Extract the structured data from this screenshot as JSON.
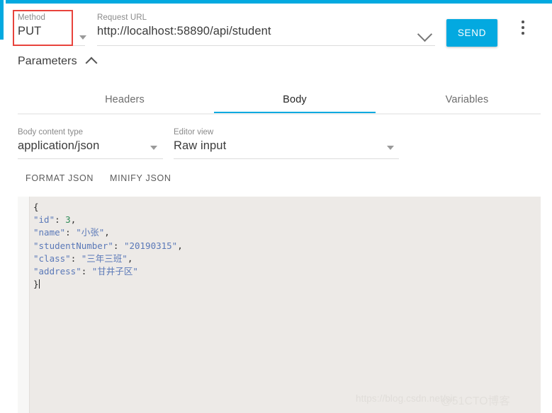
{
  "accent_color": "#03a9e0",
  "highlight_box_color": "#e8433c",
  "request": {
    "method_label": "Method",
    "method_value": "PUT",
    "url_label": "Request URL",
    "url_value": "http://localhost:58890/api/student",
    "send_label": "SEND"
  },
  "parameters": {
    "label": "Parameters"
  },
  "tabs": [
    {
      "label": "Headers",
      "active": false
    },
    {
      "label": "Body",
      "active": true
    },
    {
      "label": "Variables",
      "active": false
    }
  ],
  "body_options": {
    "content_type_label": "Body content type",
    "content_type_value": "application/json",
    "editor_view_label": "Editor view",
    "editor_view_value": "Raw input"
  },
  "json_actions": {
    "format": "FORMAT JSON",
    "minify": "MINIFY JSON"
  },
  "editor": {
    "raw_text": "{\n\"id\": 3,\n\"name\": \"小张\",\n\"studentNumber\": \"20190315\",\n\"class\": \"三年三班\",\n\"address\": \"甘井子区\"\n}",
    "lines": [
      {
        "tokens": [
          {
            "t": "{",
            "c": "punc"
          }
        ]
      },
      {
        "tokens": [
          {
            "t": "\"id\"",
            "c": "key"
          },
          {
            "t": ": ",
            "c": "punc"
          },
          {
            "t": "3",
            "c": "num"
          },
          {
            "t": ",",
            "c": "punc"
          }
        ]
      },
      {
        "tokens": [
          {
            "t": "\"name\"",
            "c": "key"
          },
          {
            "t": ": ",
            "c": "punc"
          },
          {
            "t": "\"小张\"",
            "c": "str"
          },
          {
            "t": ",",
            "c": "punc"
          }
        ]
      },
      {
        "tokens": [
          {
            "t": "\"studentNumber\"",
            "c": "key"
          },
          {
            "t": ": ",
            "c": "punc"
          },
          {
            "t": "\"20190315\"",
            "c": "str"
          },
          {
            "t": ",",
            "c": "punc"
          }
        ]
      },
      {
        "tokens": [
          {
            "t": "\"class\"",
            "c": "key"
          },
          {
            "t": ": ",
            "c": "punc"
          },
          {
            "t": "\"三年三班\"",
            "c": "str"
          },
          {
            "t": ",",
            "c": "punc"
          }
        ]
      },
      {
        "tokens": [
          {
            "t": "\"address\"",
            "c": "key"
          },
          {
            "t": ": ",
            "c": "punc"
          },
          {
            "t": "\"甘井子区\"",
            "c": "str"
          }
        ]
      },
      {
        "tokens": [
          {
            "t": "}",
            "c": "punc"
          }
        ],
        "caret": true
      }
    ],
    "json_values": {
      "id": 3,
      "name": "小张",
      "studentNumber": "20190315",
      "class": "三年三班",
      "address": "甘井子区"
    }
  },
  "watermark": {
    "csdn": "https://blog.csdn.net/sir",
    "cto": "@51CTO博客"
  }
}
